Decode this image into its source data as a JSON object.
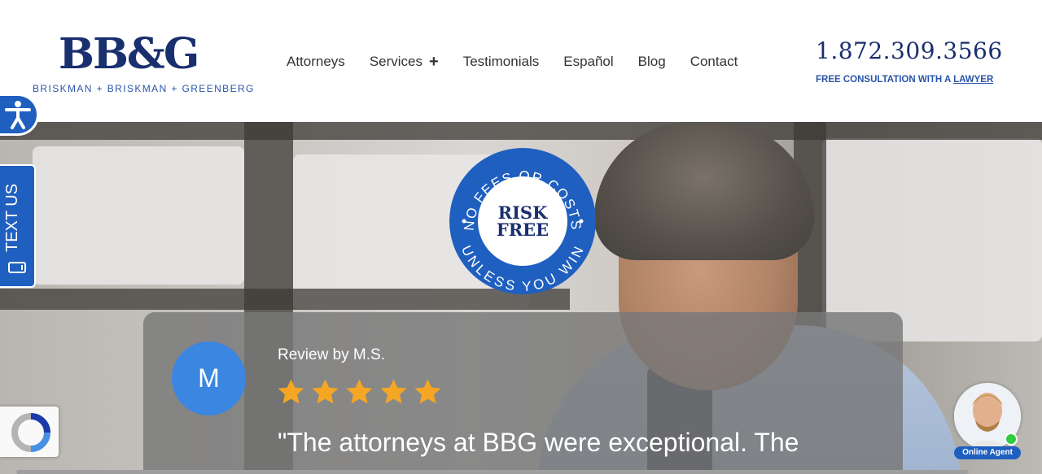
{
  "logo": {
    "mark": "BB&G",
    "subtitle": "BRISKMAN + BRISKMAN + GREENBERG"
  },
  "nav": {
    "items": [
      {
        "label": "Attorneys"
      },
      {
        "label": "Services",
        "has_submenu": true,
        "submenu_icon": "+"
      },
      {
        "label": "Testimonials"
      },
      {
        "label": "Español"
      },
      {
        "label": "Blog"
      },
      {
        "label": "Contact"
      }
    ]
  },
  "contact": {
    "phone": "1.872.309.3566",
    "consult_text": "FREE CONSULTATION WITH A ",
    "consult_link": "LAWYER"
  },
  "badge": {
    "top_arc": "NO FEES OR COSTS",
    "bottom_arc": "UNLESS YOU WIN",
    "line1": "RISK",
    "line2": "FREE"
  },
  "review": {
    "avatar_letter": "M",
    "by": "Review by M.S.",
    "rating": 5,
    "quote": "\"The attorneys at BBG were exceptional. The"
  },
  "widgets": {
    "text_us": "TEXT US",
    "agent_label": "Online Agent"
  },
  "colors": {
    "brand_navy": "#1a2f6e",
    "brand_blue": "#1f5fc0",
    "star": "#f5a623",
    "online": "#2ecc40"
  }
}
